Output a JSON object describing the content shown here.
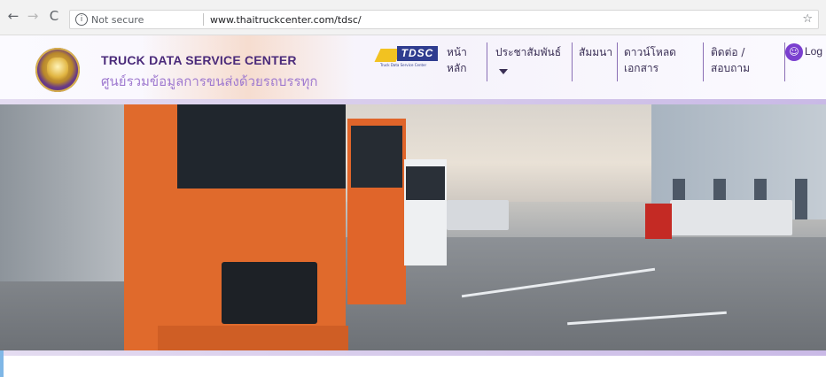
{
  "browser": {
    "secure_label": "Not secure",
    "url": "www.thaitruckcenter.com/tdsc/",
    "back_glyph": "←",
    "forward_glyph": "→",
    "reload_glyph": "C",
    "info_glyph": "i",
    "star_glyph": "☆"
  },
  "header": {
    "title": "TRUCK DATA SERVICE CENTER",
    "subtitle": "ศูนย์รวมข้อมูลการขนส่งด้วยรถบรรทุก",
    "logo_text": "TDSC",
    "logo_tagline": "Truck Data Service Center",
    "nav": [
      {
        "line1": "หน้า",
        "line2": "หลัก"
      },
      {
        "line1": "ประชาสัมพันธ์",
        "line2": ""
      },
      {
        "line1": "สัมมนา",
        "line2": ""
      },
      {
        "line1": "ดาวน์โหลด",
        "line2": "เอกสาร"
      },
      {
        "line1": "ติดต่อ /",
        "line2": "สอบถาม"
      }
    ],
    "login_label": "Log",
    "login_icon_glyph": "☺"
  },
  "colors": {
    "brand_purple": "#4a2a7a",
    "sub_purple": "#a07bd0",
    "logo_blue": "#2f3d8f",
    "logo_yellow": "#f2c221",
    "truck_orange": "#e06a2c"
  },
  "icons": [
    "back-arrow-icon",
    "forward-arrow-icon",
    "reload-icon",
    "info-icon",
    "star-icon",
    "user-icon",
    "dropdown-caret-icon"
  ]
}
